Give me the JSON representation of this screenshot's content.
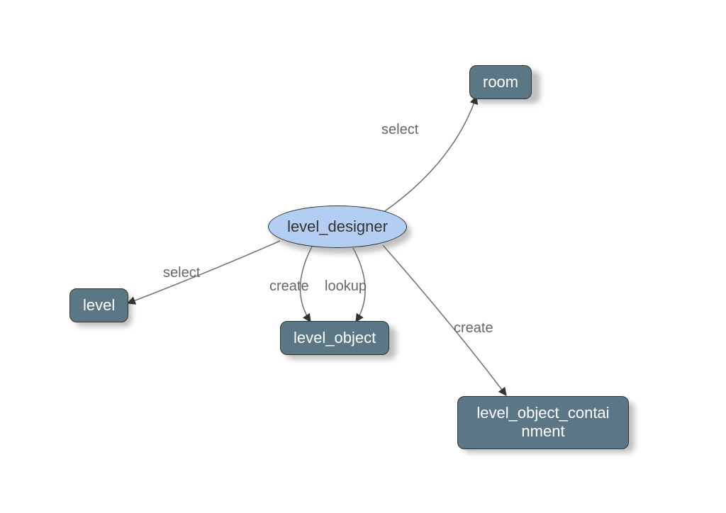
{
  "nodes": {
    "center": {
      "label": "level_designer"
    },
    "room": {
      "label": "room"
    },
    "level": {
      "label": "level"
    },
    "level_object": {
      "label": "level_object"
    },
    "containment": {
      "label": "level_object_contai\nnment"
    }
  },
  "edges": {
    "to_room": {
      "label": "select"
    },
    "to_level": {
      "label": "select"
    },
    "to_levelobj_create": {
      "label": "create"
    },
    "to_levelobj_lookup": {
      "label": "lookup"
    },
    "to_containment": {
      "label": "create"
    }
  },
  "colors": {
    "ellipse_fill": "#b3cef2",
    "rect_fill": "#5b7684",
    "stroke": "#6f6f6f"
  }
}
